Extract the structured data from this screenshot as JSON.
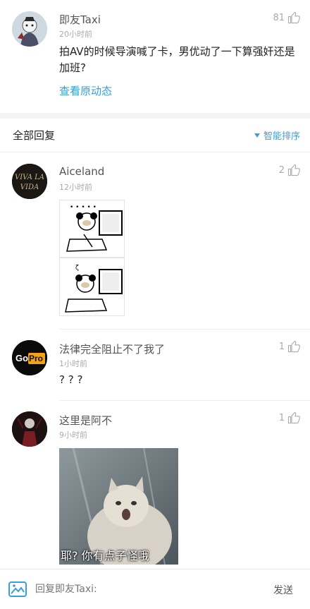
{
  "original_post": {
    "author": "即友Taxi",
    "time": "20小时前",
    "likes": "81",
    "text": "拍AV的时候导演喊了卡，男优动了一下算强奸还是加班?",
    "view_original": "查看原动态"
  },
  "replies_header": {
    "title": "全部回复",
    "sort_label": "智能排序"
  },
  "replies": [
    {
      "author": "Aiceland",
      "time": "12小时前",
      "likes": "2",
      "avatar_text": "VIVA LA VIDA",
      "image_kind": "meme-comic"
    },
    {
      "author": "法律完全阻止不了我了",
      "time": "1小时前",
      "likes": "1",
      "avatar_text": "GoPro",
      "text": "? ? ?"
    },
    {
      "author": "这里是阿不",
      "time": "9小时前",
      "likes": "1",
      "image_kind": "cat-photo",
      "image_caption": "耶? 你有点子怪哦"
    }
  ],
  "bottom_bar": {
    "placeholder": "回复即友Taxi:",
    "send_label": "发送"
  },
  "icons": {
    "like": "thumbs-up-icon",
    "sort": "triangle-down-icon",
    "image": "image-icon"
  },
  "colors": {
    "accent": "#3a9fd8",
    "muted": "#aaaaaa"
  }
}
